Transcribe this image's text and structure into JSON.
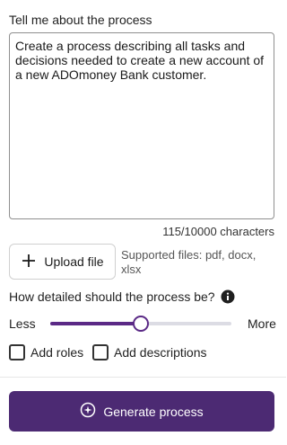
{
  "prompt": {
    "label": "Tell me about the process",
    "value": "Create a process describing all tasks and decisions needed to create a new account of a new ADOmoney Bank customer.",
    "char_count": "115/10000 characters"
  },
  "upload": {
    "button_label": "Upload file",
    "supported_text": "Supported files: pdf, docx, xlsx"
  },
  "detail": {
    "label": "How detailed should the process be?",
    "less_label": "Less",
    "more_label": "More",
    "level_fraction": 0.5
  },
  "options": {
    "add_roles": {
      "label": "Add roles",
      "checked": false
    },
    "add_descriptions": {
      "label": "Add descriptions",
      "checked": false
    }
  },
  "generate": {
    "label": "Generate process"
  },
  "colors": {
    "accent": "#5b2a86",
    "button_bg": "#4c2a73"
  },
  "icons": {
    "upload": "plus-icon",
    "info": "info-icon",
    "generate": "sparkle-icon"
  }
}
